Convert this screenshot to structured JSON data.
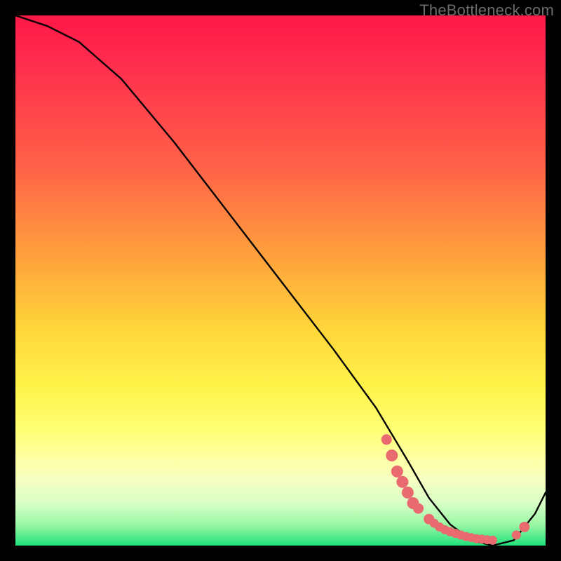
{
  "watermark": "TheBottleneck.com",
  "chart_data": {
    "type": "line",
    "title": "",
    "xlabel": "",
    "ylabel": "",
    "xlim": [
      0,
      100
    ],
    "ylim": [
      0,
      100
    ],
    "series": [
      {
        "name": "curve",
        "x": [
          0,
          6,
          12,
          20,
          30,
          40,
          50,
          60,
          68,
          74,
          78,
          82,
          86,
          90,
          94,
          98,
          100
        ],
        "y": [
          100,
          98,
          95,
          88,
          76,
          63,
          50,
          37,
          26,
          16,
          9,
          4,
          1,
          0,
          1,
          6,
          10
        ]
      }
    ],
    "highlight_points": {
      "name": "dense-dots",
      "x": [
        70,
        71,
        72,
        73,
        74,
        75,
        76,
        78,
        79,
        80,
        81,
        82,
        83,
        84,
        85,
        86,
        87,
        88,
        89,
        90,
        94.5,
        96
      ],
      "y": [
        20,
        17,
        14,
        12,
        10,
        8,
        7,
        5,
        4.2,
        3.5,
        3.0,
        2.6,
        2.3,
        2.0,
        1.7,
        1.5,
        1.3,
        1.2,
        1.1,
        1.0,
        2.0,
        3.5
      ],
      "r": [
        7,
        8,
        8,
        8,
        8,
        8,
        7,
        7,
        6,
        6,
        6,
        6,
        6,
        6,
        6,
        6,
        6,
        6,
        6,
        6,
        6,
        7
      ]
    }
  }
}
